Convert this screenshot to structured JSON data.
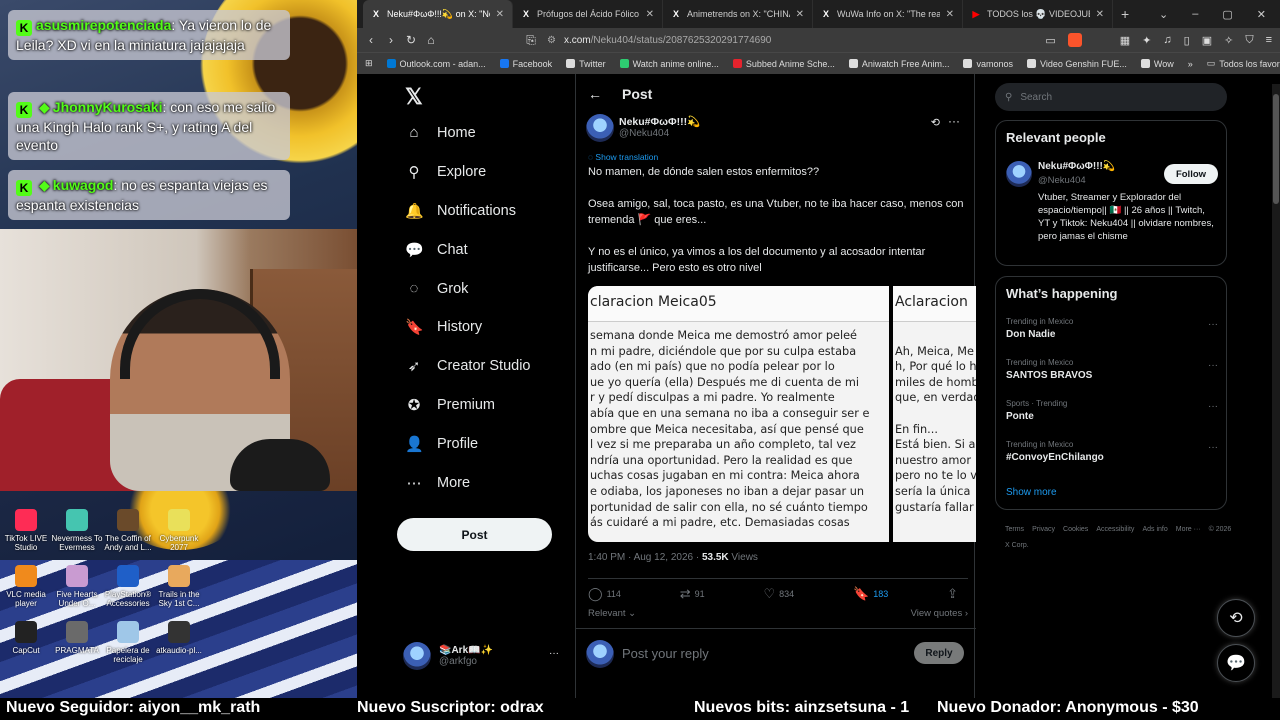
{
  "stream": {
    "chat": [
      {
        "user": "asusmirepotenciada",
        "message": ": Ya vieron lo de Leila? XD vi en la miniatura jajajajaja",
        "emote": ""
      },
      {
        "user": "JhonnyKurosaki",
        "message": ": con eso me salio una Kingh Halo rank S+, y rating A del evento",
        "emote": "◆"
      },
      {
        "user": "kuwagod",
        "message": ": no es espanta viejas es espanta existencias",
        "emote": "◆"
      }
    ],
    "desktop_icons": [
      {
        "label": "TikTok LIVE Studio",
        "color": "#fe2c55"
      },
      {
        "label": "Nevermess To Evermess",
        "color": "#45c5b0"
      },
      {
        "label": "The Coffin of Andy and L...",
        "color": "#6a4a2a"
      },
      {
        "label": "Cyberpunk 2077",
        "color": "#e9e05a"
      },
      {
        "label": "VLC media player",
        "color": "#f08a1c"
      },
      {
        "label": "Five Hearts Under O...",
        "color": "#c99bd1"
      },
      {
        "label": "PlayStation® Accessories",
        "color": "#1f5fc8"
      },
      {
        "label": "Trails in the Sky 1st C...",
        "color": "#e8a95d"
      },
      {
        "label": "CapCut",
        "color": "#222222"
      },
      {
        "label": "PRAGMATA",
        "color": "#6a6a6a"
      },
      {
        "label": "Papelera de reciclaje",
        "color": "#9fc7e8"
      },
      {
        "label": "atkaudio-pl...",
        "color": "#333333"
      }
    ]
  },
  "ticker": {
    "follower": "Nuevo Seguidor: aiyon__mk_rath",
    "subscriber": "Nuevo Suscriptor: odrax",
    "bits": "Nuevos bits: ainzsetsuna - 1",
    "donation": "Nuevo Donador: Anonymous - $30"
  },
  "browser": {
    "tabs": [
      {
        "title": "Neku#ΦωΦ!!!💫 on X: \"No m",
        "icon": "X",
        "active": true
      },
      {
        "title": "Prófugos del Ácido Fólico on X: \"...",
        "icon": "X",
        "active": false
      },
      {
        "title": "Animetrends on X: \"CHINA PROH...",
        "icon": "X",
        "active": false
      },
      {
        "title": "WuWa Info on X: \"The real Demo...",
        "icon": "X",
        "active": false
      },
      {
        "title": "TODOS los 💀 VIDEOJUEGOS 💀",
        "icon": "▶",
        "active": false
      }
    ],
    "url_host": "x.com",
    "url_path": "/Neku404/status/2087625320291774690",
    "bookmarks": [
      {
        "label": "Outlook.com - adan...",
        "color": "#0078d4"
      },
      {
        "label": "Facebook",
        "color": "#1877f2"
      },
      {
        "label": "Twitter",
        "color": "#dddddd"
      },
      {
        "label": "Watch anime online...",
        "color": "#2ecc71"
      },
      {
        "label": "Subbed Anime Sche...",
        "color": "#e5232d"
      },
      {
        "label": "Aniwatch Free Anim...",
        "color": "#dddddd"
      },
      {
        "label": "vamonos",
        "color": "#dddddd"
      },
      {
        "label": "Video Genshin FUE...",
        "color": "#dddddd"
      },
      {
        "label": "Wow",
        "color": "#dddddd"
      }
    ],
    "bookmarks_all": "Todos los favoritos"
  },
  "nav": {
    "items": [
      {
        "label": "Home",
        "icon": "home-icon",
        "glyph": "⌂"
      },
      {
        "label": "Explore",
        "icon": "search-icon",
        "glyph": "⚲"
      },
      {
        "label": "Notifications",
        "icon": "bell-icon",
        "glyph": "🔔"
      },
      {
        "label": "Chat",
        "icon": "chat-icon",
        "glyph": "💬"
      },
      {
        "label": "Grok",
        "icon": "grok-icon",
        "glyph": "◌"
      },
      {
        "label": "History",
        "icon": "bookmark-icon",
        "glyph": "🔖"
      },
      {
        "label": "Creator Studio",
        "icon": "rocket-icon",
        "glyph": "➶"
      },
      {
        "label": "Premium",
        "icon": "verified-icon",
        "glyph": "✪"
      },
      {
        "label": "Profile",
        "icon": "person-icon",
        "glyph": "👤"
      },
      {
        "label": "More",
        "icon": "more-circle-icon",
        "glyph": "⋯"
      }
    ],
    "post_label": "Post",
    "account": {
      "name": "📚Ark📖✨",
      "handle": "@arkfgo"
    }
  },
  "post": {
    "header": "Post",
    "author_name": "Neku#ΦωΦ!!!💫",
    "author_handle": "@Neku404",
    "show_translation": "Show translation",
    "paragraphs": [
      "No mamen, de dónde salen estos enfermitos??",
      "Osea amigo, sal, toca pasto, es una Vtuber, no te iba hacer caso, menos con tremenda 🚩 que eres...",
      "Y no es el único, ya vimos a los del documento y al acosador intentar justificarse... Pero esto es otro nivel"
    ],
    "image1_title": "claracion Meica05",
    "image1_text": [
      "semana donde Meica me demostró amor peleé",
      "n mi padre, diciéndole que por su culpa estaba",
      "ado (en mi país) que no podía pelear por lo",
      "ue yo quería (ella) Después me di cuenta de mi",
      "r y pedí disculpas a mi padre. Yo realmente",
      "abía que en una semana no iba a conseguir ser e",
      "ombre que Meica necesitaba, así que pensé que",
      "l vez si me preparaba un año completo, tal vez",
      "ndría una oportunidad. Pero la realidad es que",
      "uchas cosas jugaban en mi contra: Meica ahora",
      "e odiaba, los japoneses no iban a dejar pasar un",
      "portunidad de salir con ella, no sé cuánto tiempo",
      "ás cuidaré a mi padre, etc. Demasiadas cosas"
    ],
    "image2_title": "Aclaracion",
    "image2_text": [
      "",
      "Ah, Meica, Me",
      "h, Por qué lo h",
      "miles de homb",
      "que, en verdad",
      "",
      "En fin...",
      "Está bien. Si a",
      "nuestro amor",
      "pero no te lo v",
      "sería la única",
      "gustaría fallar",
      ""
    ],
    "time": "1:40 PM · Aug 12, 2026 · ",
    "views": "53.5K",
    "views_label": " Views",
    "replies": "114",
    "reposts": "91",
    "likes": "834",
    "bookmarks": "183",
    "relevant": "Relevant ⌄",
    "view_quotes": "View quotes ›",
    "reply_placeholder": "Post your reply",
    "reply_button": "Reply"
  },
  "sidebar": {
    "search_placeholder": "Search",
    "relevant_title": "Relevant people",
    "person": {
      "name": "Neku#ΦωΦ!!!💫",
      "handle": "@Neku404",
      "follow": "Follow",
      "bio": "Vtuber, Streamer y Explorador del espacio/tiempo|| 🇲🇽 || 26 años || Twitch, YT y Tiktok: Neku404 || olvidare nombres, pero jamas el chisme"
    },
    "happening_title": "What’s happening",
    "trends": [
      {
        "context": "Trending in Mexico",
        "topic": "Don Nadie"
      },
      {
        "context": "Trending in Mexico",
        "topic": "SANTOS BRAVOS"
      },
      {
        "context": "Sports · Trending",
        "topic": "Ponte"
      },
      {
        "context": "Trending in Mexico",
        "topic": "#ConvoyEnChilango"
      }
    ],
    "show_more": "Show more",
    "footer": [
      "Terms",
      "Privacy",
      "Cookies",
      "Accessibility",
      "Ads info",
      "More ···",
      "© 2026 X Corp."
    ]
  }
}
